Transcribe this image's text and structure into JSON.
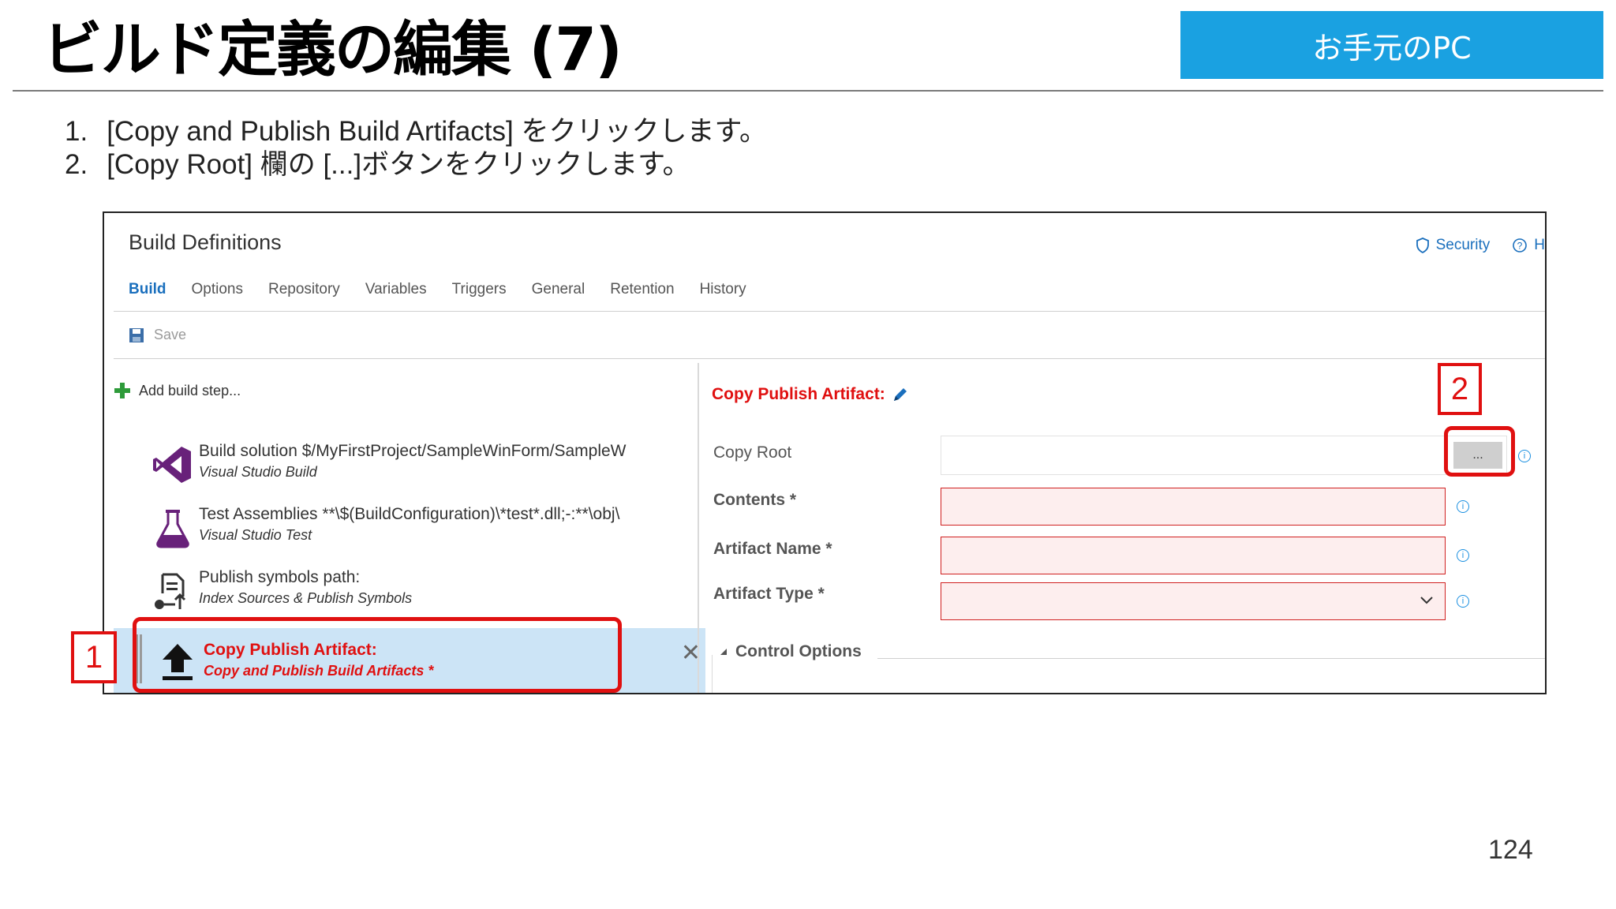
{
  "slide": {
    "title": "ビルド定義の編集 (7)",
    "badge": "お手元のPC",
    "steps": [
      {
        "num": "1.",
        "text": "[Copy and Publish Build Artifacts] をクリックします。"
      },
      {
        "num": "2.",
        "text": "[Copy Root] 欄の [...]ボタンをクリックします。"
      }
    ],
    "page_number": "124",
    "callouts": [
      "1",
      "2"
    ]
  },
  "app": {
    "title": "Build Definitions",
    "links": {
      "security": "Security",
      "help": "H"
    },
    "tabs": [
      "Build",
      "Options",
      "Repository",
      "Variables",
      "Triggers",
      "General",
      "Retention",
      "History"
    ],
    "active_tab": "Build",
    "toolbar": {
      "save": "Save"
    },
    "add_step": "Add build step...",
    "tasks": [
      {
        "name": "Build solution $/MyFirstProject/SampleWinForm/SampleW",
        "type": "Visual Studio Build",
        "icon": "visual-studio-icon"
      },
      {
        "name": "Test Assemblies **\\$(BuildConfiguration)\\*test*.dll;-:**\\obj\\",
        "type": "Visual Studio Test",
        "icon": "flask-icon"
      },
      {
        "name": "Publish symbols path:",
        "type": "Index Sources & Publish Symbols",
        "icon": "publish-symbols-icon"
      },
      {
        "name": "Copy Publish Artifact:",
        "type": "Copy and Publish Build Artifacts *",
        "icon": "upload-icon",
        "selected": true
      }
    ],
    "form": {
      "title": "Copy Publish Artifact:",
      "fields": [
        {
          "label": "Copy Root",
          "value": "",
          "button": "..."
        },
        {
          "label": "Contents *",
          "value": ""
        },
        {
          "label": "Artifact Name *",
          "value": ""
        },
        {
          "label": "Artifact Type *",
          "value": ""
        }
      ],
      "control_options": "Control Options"
    }
  },
  "colors": {
    "accent": "#1aa1e1",
    "callout": "#e01010",
    "link": "#1a6fbd",
    "selected_row": "#cce4f6"
  }
}
